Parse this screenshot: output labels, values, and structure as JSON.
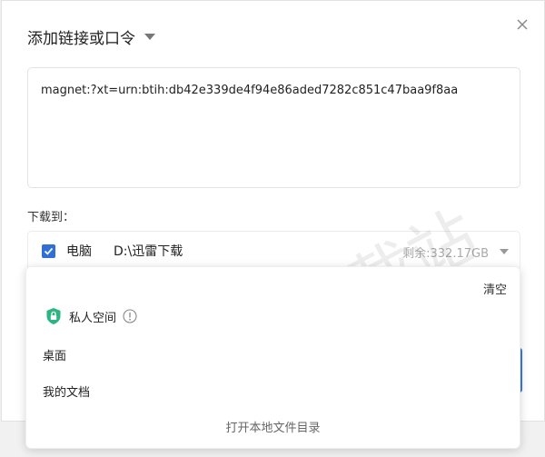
{
  "dialog": {
    "title": "添加链接或口令",
    "link_text": "magnet:?xt=urn:btih:db42e339de4f94e86aded7282c851c47baa9f8aa"
  },
  "download": {
    "label": "下载到：",
    "target_name": "电脑",
    "path": "D:\\迅雷下载",
    "free_space": "剩余:332.17GB",
    "checked": true
  },
  "dropdown": {
    "clear_label": "清空",
    "private_space_label": "私人空间",
    "items": [
      "桌面",
      "我的文档"
    ],
    "open_local_label": "打开本地文件目录"
  },
  "watermark": {
    "text": "天极下载站"
  },
  "colors": {
    "accent": "#2f6fd6",
    "shield": "#2bb580"
  }
}
